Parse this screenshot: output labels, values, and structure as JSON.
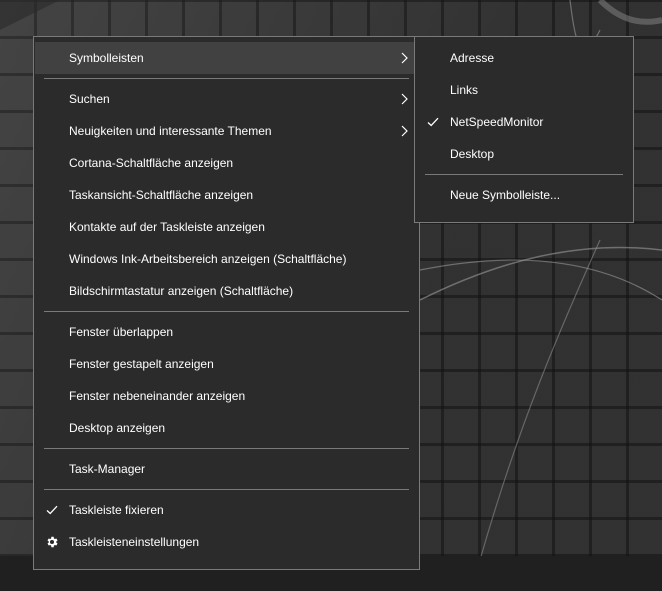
{
  "main_menu": {
    "groups": [
      [
        {
          "label": "Symbolleisten",
          "submenu": true,
          "hovered": true
        }
      ],
      [
        {
          "label": "Suchen",
          "submenu": true
        },
        {
          "label": "Neuigkeiten und interessante Themen",
          "submenu": true
        },
        {
          "label": "Cortana-Schaltfläche anzeigen"
        },
        {
          "label": "Taskansicht-Schaltfläche anzeigen"
        },
        {
          "label": "Kontakte auf der Taskleiste anzeigen"
        },
        {
          "label": "Windows Ink-Arbeitsbereich anzeigen (Schaltfläche)"
        },
        {
          "label": "Bildschirmtastatur anzeigen (Schaltfläche)"
        }
      ],
      [
        {
          "label": "Fenster überlappen"
        },
        {
          "label": "Fenster gestapelt anzeigen"
        },
        {
          "label": "Fenster nebeneinander anzeigen"
        },
        {
          "label": "Desktop anzeigen"
        }
      ],
      [
        {
          "label": "Task-Manager"
        }
      ],
      [
        {
          "label": "Taskleiste fixieren",
          "checked": true
        },
        {
          "label": "Taskleisteneinstellungen",
          "icon": "gear-icon"
        }
      ]
    ]
  },
  "sub_menu": {
    "groups": [
      [
        {
          "label": "Adresse"
        },
        {
          "label": "Links"
        },
        {
          "label": "NetSpeedMonitor",
          "checked": true
        },
        {
          "label": "Desktop"
        }
      ],
      [
        {
          "label": "Neue Symbolleiste..."
        }
      ]
    ]
  },
  "colors": {
    "menu_bg": "#2b2b2b",
    "hover_bg": "#414141",
    "text": "#ffffff",
    "border": "#7a7a7a"
  }
}
